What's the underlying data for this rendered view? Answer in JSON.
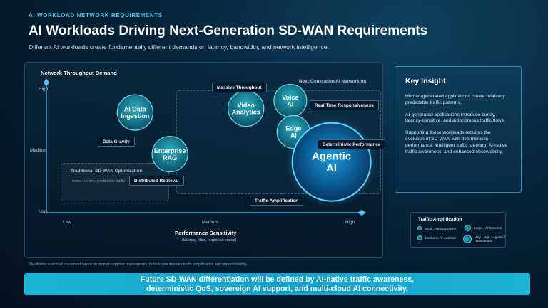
{
  "header": {
    "eyebrow": "AI WORKLOAD NETWORK REQUIREMENTS",
    "title": "AI Workloads Driving Next-Generation SD-WAN Requirements",
    "subtitle": "Different AI workloads create fundamentally different demands on latency, bandwidth, and network intelligence."
  },
  "chart_data": {
    "type": "scatter",
    "ylabel": "Network Throughput Demand",
    "xlabel": "Performance Sensitivity",
    "xlabel_sub": "(latency, jitter, responsiveness)",
    "x_ticks": [
      "Low",
      "Medium",
      "High"
    ],
    "y_ticks": [
      "High",
      "Medium",
      "Low"
    ],
    "xlim": [
      0,
      1
    ],
    "ylim": [
      0,
      1
    ],
    "grid": false,
    "points": [
      {
        "label": [
          "AI Data",
          "Ingestion"
        ],
        "x": 0.28,
        "y": 0.77,
        "size": "medium"
      },
      {
        "label": [
          "Video",
          "Analytics"
        ],
        "x": 0.63,
        "y": 0.8,
        "size": "medium"
      },
      {
        "label": [
          "Voice",
          "AI"
        ],
        "x": 0.77,
        "y": 0.86,
        "size": "small"
      },
      {
        "label": [
          "Edge",
          "AI"
        ],
        "x": 0.78,
        "y": 0.62,
        "size": "small"
      },
      {
        "label": [
          "Enterprise",
          "RAG"
        ],
        "x": 0.39,
        "y": 0.45,
        "size": "medium"
      },
      {
        "label": [
          "Agentic",
          "AI"
        ],
        "x": 0.9,
        "y": 0.39,
        "size": "very-large"
      }
    ],
    "annotations": {
      "massive_throughput": "Massive Throughput",
      "real_time": "Real-Time Responsiveness",
      "data_gravity": "Data Gravity",
      "deterministic": "Deterministic Performance",
      "distributed_retrieval": "Distributed Retrieval",
      "traffic_amplification": "Traffic Amplification"
    },
    "zones": {
      "traditional": {
        "title": "Traditional SD-WAN Optimization",
        "subtitle": "Human-centric, predictable traffic"
      },
      "next_gen": {
        "title": "Next-Generation AI Networking"
      }
    },
    "footnote": "Qualitative workload placement based on prompt-supplied requirements; bubble size denotes traffic amplification and unpredictability."
  },
  "insight": {
    "title": "Key Insight",
    "paragraphs": [
      "Human-generated applications create relatively predictable traffic patterns.",
      "AI-generated applications introduce bursty, latency-sensitive, and autonomous traffic flows.",
      "Supporting these workloads requires the evolution of SD-WAN with deterministic performance, intelligent traffic steering, AI-native traffic awareness, and enhanced observability."
    ]
  },
  "legend": {
    "title": "Traffic Amplification",
    "items": [
      {
        "label": "Small = Human-Driven"
      },
      {
        "label": "Large = AI-Intensive"
      },
      {
        "label": "Medium = AI-Assisted"
      },
      {
        "label": "Very Large = Agentic / Autonomous"
      }
    ]
  },
  "banner": {
    "line1": "Future SD-WAN differentiation will be defined by AI-native traffic awareness,",
    "line2": "deterministic QoS, sovereign AI support, and multi-cloud AI connectivity."
  },
  "colors": {
    "accent": "#3fc4e8",
    "bubble": "#1f8fa6",
    "agentic": "#0b6fb0",
    "banner": "#1bb6d6"
  }
}
